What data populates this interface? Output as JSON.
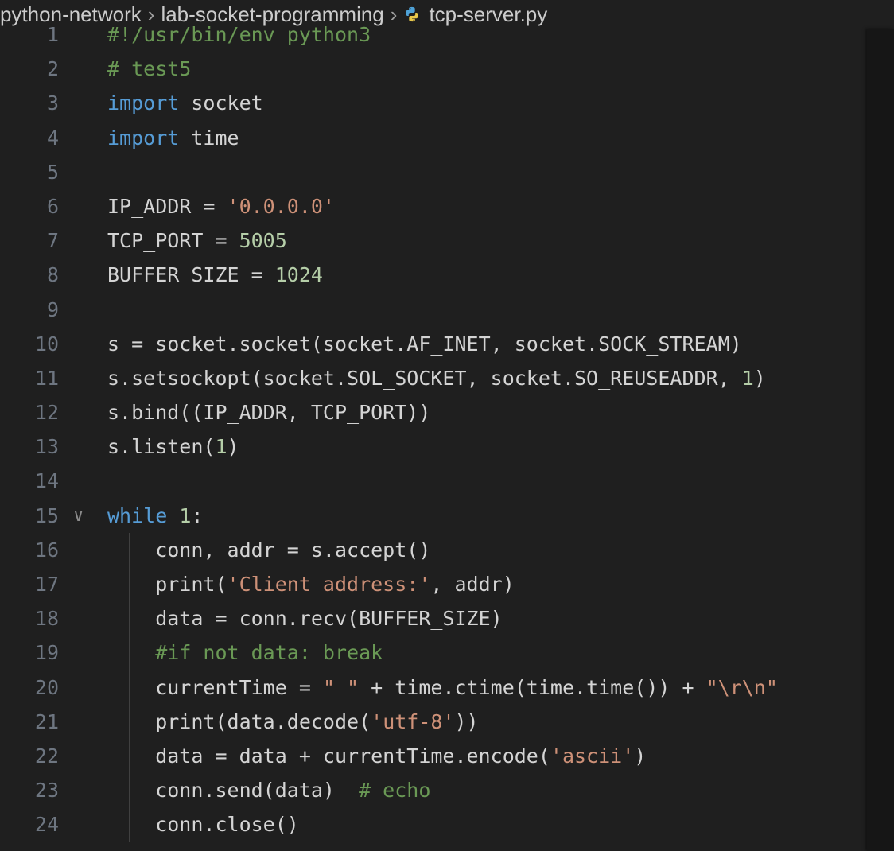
{
  "breadcrumb": {
    "items": [
      "python-network",
      "lab-socket-programming",
      "tcp-server.py"
    ],
    "separator": ">"
  },
  "colors": {
    "background": "#1f1f1f",
    "keyword": "#569cd6",
    "comment": "#6a9955",
    "string": "#ce9178",
    "number": "#b5cea8",
    "text": "#d4d4d4",
    "line_number": "#6e7681"
  },
  "icons": {
    "file_icon": "python-icon",
    "fold_icon": "chevron-down-icon"
  },
  "code": {
    "fold_marker_line": 15,
    "lines": [
      {
        "n": "1",
        "tokens": [
          [
            "cm",
            "#!/usr/bin/env python3"
          ]
        ]
      },
      {
        "n": "2",
        "tokens": [
          [
            "cm",
            "# test5"
          ]
        ]
      },
      {
        "n": "3",
        "tokens": [
          [
            "kw",
            "import"
          ],
          [
            "id",
            " socket"
          ]
        ]
      },
      {
        "n": "4",
        "tokens": [
          [
            "kw",
            "import"
          ],
          [
            "id",
            " time"
          ]
        ]
      },
      {
        "n": "5",
        "tokens": []
      },
      {
        "n": "6",
        "tokens": [
          [
            "id",
            "IP_ADDR = "
          ],
          [
            "st",
            "'0.0.0.0'"
          ]
        ]
      },
      {
        "n": "7",
        "tokens": [
          [
            "id",
            "TCP_PORT = "
          ],
          [
            "nm",
            "5005"
          ]
        ]
      },
      {
        "n": "8",
        "tokens": [
          [
            "id",
            "BUFFER_SIZE = "
          ],
          [
            "nm",
            "1024"
          ]
        ]
      },
      {
        "n": "9",
        "tokens": []
      },
      {
        "n": "10",
        "tokens": [
          [
            "id",
            "s = socket.socket(socket.AF_INET, socket.SOCK_STREAM)"
          ]
        ]
      },
      {
        "n": "11",
        "tokens": [
          [
            "id",
            "s.setsockopt(socket.SOL_SOCKET, socket.SO_REUSEADDR, "
          ],
          [
            "nm",
            "1"
          ],
          [
            "id",
            ")"
          ]
        ]
      },
      {
        "n": "12",
        "tokens": [
          [
            "id",
            "s.bind((IP_ADDR, TCP_PORT))"
          ]
        ]
      },
      {
        "n": "13",
        "tokens": [
          [
            "id",
            "s.listen("
          ],
          [
            "nm",
            "1"
          ],
          [
            "id",
            ")"
          ]
        ]
      },
      {
        "n": "14",
        "tokens": []
      },
      {
        "n": "15",
        "tokens": [
          [
            "kw",
            "while"
          ],
          [
            "id",
            " "
          ],
          [
            "nm",
            "1"
          ],
          [
            "id",
            ":"
          ]
        ]
      },
      {
        "n": "16",
        "indent": true,
        "tokens": [
          [
            "id",
            "    conn, addr = s.accept()"
          ]
        ]
      },
      {
        "n": "17",
        "indent": true,
        "tokens": [
          [
            "id",
            "    print("
          ],
          [
            "st",
            "'Client address:'"
          ],
          [
            "id",
            ", addr)"
          ]
        ]
      },
      {
        "n": "18",
        "indent": true,
        "tokens": [
          [
            "id",
            "    data = conn.recv(BUFFER_SIZE)"
          ]
        ]
      },
      {
        "n": "19",
        "indent": true,
        "tokens": [
          [
            "id",
            "    "
          ],
          [
            "cm",
            "#if not data: break"
          ]
        ]
      },
      {
        "n": "20",
        "indent": true,
        "tokens": [
          [
            "id",
            "    currentTime = "
          ],
          [
            "st",
            "\" \""
          ],
          [
            "id",
            " + time.ctime(time.time()) + "
          ],
          [
            "st",
            "\"\\r\\n\""
          ]
        ]
      },
      {
        "n": "21",
        "indent": true,
        "tokens": [
          [
            "id",
            "    print(data.decode("
          ],
          [
            "st",
            "'utf-8'"
          ],
          [
            "id",
            "))"
          ]
        ]
      },
      {
        "n": "22",
        "indent": true,
        "tokens": [
          [
            "id",
            "    data = data + currentTime.encode("
          ],
          [
            "st",
            "'ascii'"
          ],
          [
            "id",
            ")"
          ]
        ]
      },
      {
        "n": "23",
        "indent": true,
        "tokens": [
          [
            "id",
            "    conn.send(data)  "
          ],
          [
            "cm",
            "# echo"
          ]
        ]
      },
      {
        "n": "24",
        "indent": true,
        "tokens": [
          [
            "id",
            "    conn.close()"
          ]
        ]
      }
    ]
  }
}
